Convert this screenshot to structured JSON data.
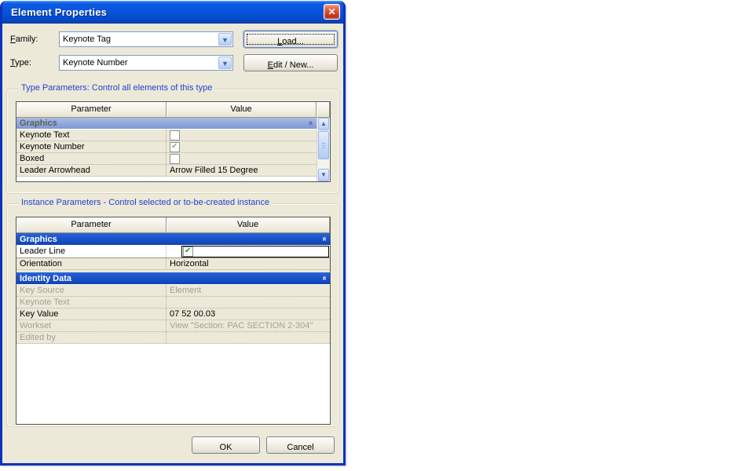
{
  "window": {
    "title": "Element Properties"
  },
  "icons": {
    "close": "✕",
    "dropdown": "▼",
    "scroll_up": "▲",
    "scroll_down": "▼",
    "collapse": "»"
  },
  "family": {
    "label_u": "F",
    "label_rest": "amily:",
    "value": "Keynote Tag"
  },
  "type": {
    "label_u": "T",
    "label_rest": "ype:",
    "value": "Keynote Number"
  },
  "buttons": {
    "load_u": "L",
    "load_rest": "oad...",
    "edit_u": "E",
    "edit_rest": "dit / New...",
    "ok": "OK",
    "cancel": "Cancel"
  },
  "type_params": {
    "legend": "Type Parameters: Control all elements of this type",
    "headers": {
      "parameter": "Parameter",
      "value": "Value"
    },
    "rows": [
      {
        "param": "Graphics",
        "kind": "group",
        "collapsed": false
      },
      {
        "param": "Keynote Text",
        "kind": "checkbox",
        "checked": false
      },
      {
        "param": "Keynote Number",
        "kind": "checkbox-disabled",
        "checked": true
      },
      {
        "param": "Boxed",
        "kind": "checkbox",
        "checked": false
      },
      {
        "param": "Leader Arrowhead",
        "kind": "text",
        "value": "Arrow Filled 15 Degree"
      }
    ]
  },
  "instance_params": {
    "legend": "Instance Parameters - Control selected or to-be-created instance",
    "headers": {
      "parameter": "Parameter",
      "value": "Value"
    },
    "rows": [
      {
        "param": "Graphics",
        "kind": "group",
        "collapsed": false
      },
      {
        "param": "Leader Line",
        "kind": "edit-checkbox",
        "checked": true,
        "value": ""
      },
      {
        "param": "Orientation",
        "kind": "text",
        "value": "Horizontal"
      },
      {
        "param": "Identity Data",
        "kind": "group",
        "collapsed": false
      },
      {
        "param": "Key Source",
        "kind": "text-disabled",
        "value": "Element"
      },
      {
        "param": "Keynote Text",
        "kind": "text-disabled",
        "value": ""
      },
      {
        "param": "Key Value",
        "kind": "text",
        "value": "07 52 00.03"
      },
      {
        "param": "Workset",
        "kind": "text-disabled",
        "value": "View \"Section: PAC SECTION 2-304\""
      },
      {
        "param": "Edited by",
        "kind": "text-disabled",
        "value": ""
      }
    ]
  },
  "colors": {
    "titlebar_blue": "#0754da",
    "window_border": "#0a34bb",
    "dialog_bg": "#ece9d8",
    "group_label_blue": "#2441cf",
    "group_header_dark": "#1850c6",
    "group_header_light": "#8fa5da",
    "disabled_text": "#a3a094",
    "check_green": "#1fa11f",
    "close_red": "#cc3a20",
    "combo_border": "#7f9db9"
  }
}
